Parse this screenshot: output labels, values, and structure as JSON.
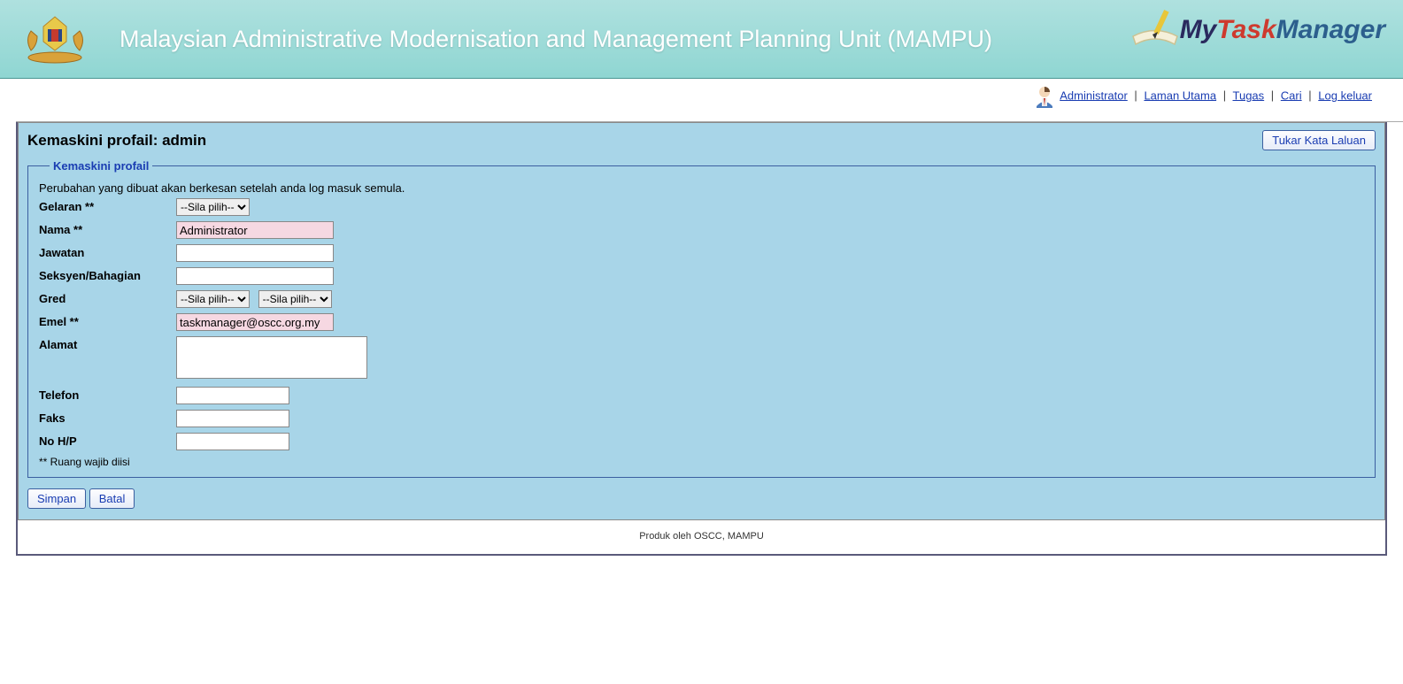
{
  "header": {
    "title": "Malaysian Administrative Modernisation and Management Planning Unit (MAMPU)",
    "logo_my": "My",
    "logo_task": "Task",
    "logo_manager": "Manager"
  },
  "nav": {
    "user": "Administrator",
    "home": "Laman Utama",
    "tasks": "Tugas",
    "search": "Cari",
    "logout": "Log keluar"
  },
  "page": {
    "title": "Kemaskini profail: admin",
    "change_password": "Tukar Kata Laluan"
  },
  "form": {
    "legend": "Kemaskini profail",
    "info": "Perubahan yang dibuat akan berkesan setelah anda log masuk semula.",
    "fields": {
      "gelaran_label": "Gelaran **",
      "gelaran_value": "--Sila pilih--",
      "nama_label": "Nama **",
      "nama_value": "Administrator",
      "jawatan_label": "Jawatan",
      "jawatan_value": "",
      "seksyen_label": "Seksyen/Bahagian",
      "seksyen_value": "",
      "gred_label": "Gred",
      "gred_value1": "--Sila pilih--",
      "gred_value2": "--Sila pilih--",
      "emel_label": "Emel **",
      "emel_value": "taskmanager@oscc.org.my",
      "alamat_label": "Alamat",
      "alamat_value": "",
      "telefon_label": "Telefon",
      "telefon_value": "",
      "faks_label": "Faks",
      "faks_value": "",
      "nohp_label": "No H/P",
      "nohp_value": ""
    },
    "footnote": "** Ruang wajib diisi",
    "save": "Simpan",
    "cancel": "Batal"
  },
  "footer": "Produk oleh OSCC, MAMPU"
}
